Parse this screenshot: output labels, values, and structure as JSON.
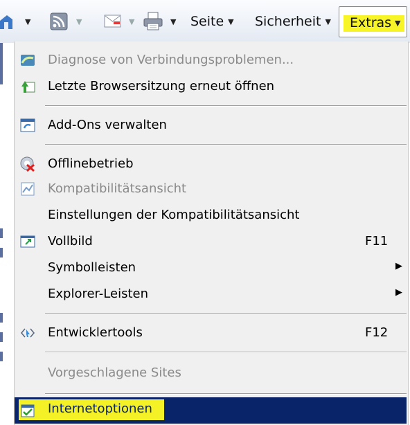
{
  "toolbar": {
    "items": [
      {
        "name": "home"
      },
      {
        "name": "feeds"
      },
      {
        "name": "mail"
      },
      {
        "name": "print"
      }
    ],
    "page_label": "Seite",
    "safety_label": "Sicherheit",
    "extras_label": "Extras"
  },
  "menu": {
    "items": [
      {
        "label": "Diagnose von Verbindungsproblemen...",
        "icon": "network-diagnose-icon",
        "disabled": true
      },
      {
        "label": "Letzte Browsersitzung erneut öffnen",
        "icon": "reopen-session-icon",
        "disabled": false
      },
      {
        "label": "Add-Ons verwalten",
        "icon": "addons-icon",
        "disabled": false
      },
      {
        "label": "Offlinebetrieb",
        "icon": "offline-icon",
        "disabled": false
      },
      {
        "label": "Kompatibilitätsansicht",
        "icon": "compat-view-icon",
        "disabled": true
      },
      {
        "label": "Einstellungen der Kompatibilitätsansicht",
        "icon": "",
        "disabled": false
      },
      {
        "label": "Vollbild",
        "icon": "fullscreen-icon",
        "shortcut": "F11",
        "disabled": false
      },
      {
        "label": "Symbolleisten",
        "icon": "",
        "submenu": true,
        "disabled": false
      },
      {
        "label": "Explorer-Leisten",
        "icon": "",
        "submenu": true,
        "disabled": false
      },
      {
        "label": "Entwicklertools",
        "icon": "dev-tools-icon",
        "shortcut": "F12",
        "disabled": false
      },
      {
        "label": "Vorgeschlagene Sites",
        "icon": "",
        "disabled": true
      },
      {
        "label": "Internetoptionen",
        "icon": "internet-options-icon",
        "disabled": false,
        "selected": true
      }
    ]
  },
  "colors": {
    "highlight_yellow": "#f4f227",
    "selection_blue": "#0a246a",
    "menu_bg": "#f0f0f0",
    "disabled_text": "#8a8a8a"
  }
}
